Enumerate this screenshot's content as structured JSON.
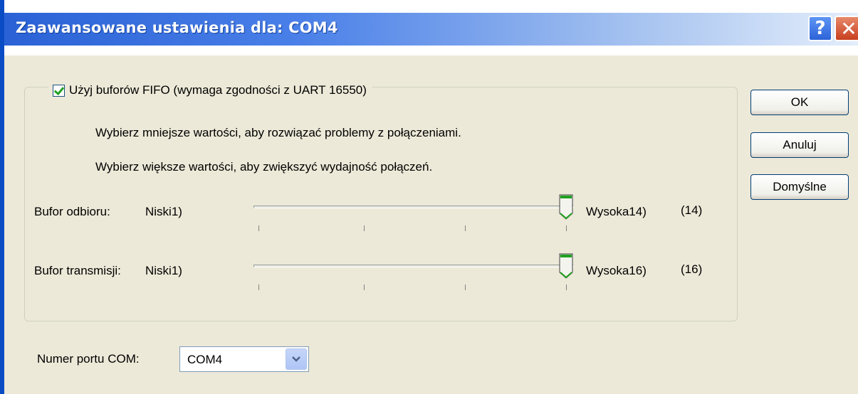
{
  "window": {
    "title": "Zaawansowane ustawienia dla: COM4",
    "help_glyph": "?",
    "close_glyph": "✕"
  },
  "fifo": {
    "checked": true,
    "label": "Użyj buforów FIFO (wymaga zgodności z UART 16550)"
  },
  "hints": {
    "lower": "Wybierz mniejsze wartości, aby rozwiązać problemy z połączeniami.",
    "higher": "Wybierz większe wartości, aby zwiększyć wydajność połączeń."
  },
  "receive": {
    "label": "Bufor odbioru:",
    "min_label": "Niski1)",
    "max_label": "Wysoka14)",
    "value_display": "(14)",
    "level": 1.0
  },
  "transmit": {
    "label": "Bufor transmisji:",
    "min_label": "Niski1)",
    "max_label": "Wysoka16)",
    "value_display": "(16)",
    "level": 1.0
  },
  "buttons": {
    "ok": "OK",
    "cancel": "Anuluj",
    "defaults": "Domyślne"
  },
  "port": {
    "label": "Numer portu COM:",
    "value": "COM4"
  },
  "colors": {
    "title_blue": "#2A62D6",
    "dialog_bg": "#ECE9D8",
    "thumb_green": "#21A121"
  }
}
